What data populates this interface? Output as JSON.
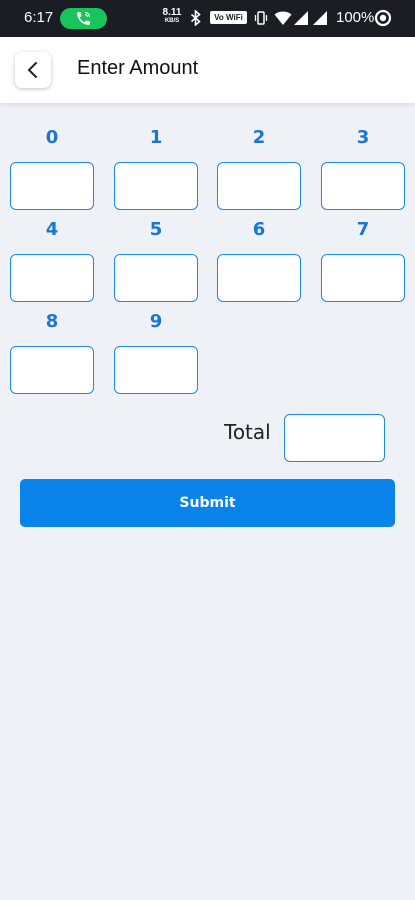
{
  "status_bar": {
    "time": "6:17",
    "net_speed_value": "8.11",
    "net_speed_unit": "KB/S",
    "vowifi_label": "Vo WiFi",
    "battery_percent": "100%",
    "call_indicator_color": "#19c45a"
  },
  "header": {
    "back_icon": "chevron-left-icon",
    "title": "Enter Amount"
  },
  "digits": [
    {
      "label": "0",
      "value": ""
    },
    {
      "label": "1",
      "value": ""
    },
    {
      "label": "2",
      "value": ""
    },
    {
      "label": "3",
      "value": ""
    },
    {
      "label": "4",
      "value": ""
    },
    {
      "label": "5",
      "value": ""
    },
    {
      "label": "6",
      "value": ""
    },
    {
      "label": "7",
      "value": ""
    },
    {
      "label": "8",
      "value": ""
    },
    {
      "label": "9",
      "value": ""
    }
  ],
  "total": {
    "label": "Total",
    "value": ""
  },
  "submit": {
    "label": "Submit"
  },
  "colors": {
    "accent": "#1976d2",
    "button": "#0a83eb",
    "background": "#eef1f5"
  }
}
